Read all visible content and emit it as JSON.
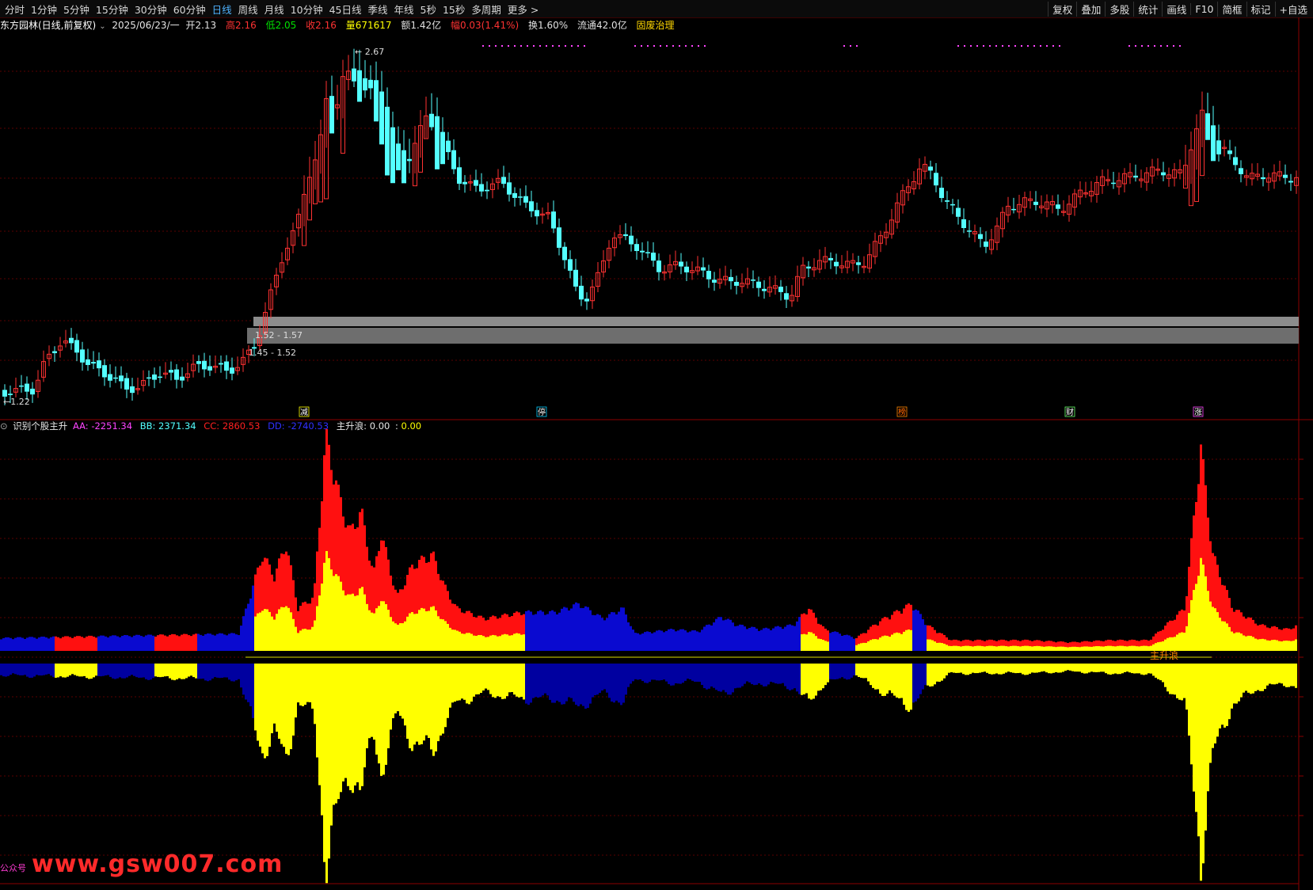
{
  "toolbar": {
    "periods": [
      "分时",
      "1分钟",
      "5分钟",
      "15分钟",
      "30分钟",
      "60分钟",
      "日线",
      "周线",
      "月线",
      "10分钟",
      "45日线",
      "季线",
      "年线",
      "5秒",
      "15秒",
      "多周期",
      "更多 >"
    ],
    "active_period": "日线",
    "right_buttons": [
      "复权",
      "叠加",
      "多股",
      "统计",
      "画线",
      "F10",
      "简框",
      "标记",
      "+自选"
    ]
  },
  "stock": {
    "title": "东方园林(日线,前复权)",
    "date": "2025/06/23/一",
    "open_label": "开",
    "open": "2.13",
    "high_label": "高",
    "high": "2.16",
    "low_label": "低",
    "low": "2.05",
    "close_label": "收",
    "close": "2.16",
    "volume_label": "量",
    "volume": "671617",
    "amount_label": "额",
    "amount": "1.42亿",
    "change_label": "幅",
    "change": "0.03(1.41%)",
    "turnover_label": "换",
    "turnover": "1.60%",
    "float_label": "流通",
    "float": "42.0亿",
    "concept": "固废治理"
  },
  "chart_labels": {
    "max_price": "2.67",
    "min_price": "1.22",
    "zone_upper": "1.52 - 1.57",
    "zone_lower": "1.45 - 1.52"
  },
  "event_markers": [
    "减",
    "停",
    "榜",
    "财",
    "涨"
  ],
  "indicator": {
    "name": "识别个股主升",
    "aa_label": "AA:",
    "aa": "-2251.34",
    "bb_label": "BB:",
    "bb": "2371.34",
    "cc_label": "CC:",
    "cc": "2860.53",
    "dd_label": "DD:",
    "dd": "-2740.53",
    "zs_label": "主升浪:",
    "zs1": "0.00",
    "zs2": "0.00",
    "signal_text": "主升浪"
  },
  "watermark": {
    "url": "www.gsw007.com",
    "small": "公众号"
  },
  "colors": {
    "up": "#ff3232",
    "down": "#54ffff",
    "aa": "#ff44ff",
    "bb": "#54ffff",
    "cc": "#ff2020",
    "dd": "#2020ff",
    "yellow": "#ffff00",
    "blue_fill": "#0a0ad0"
  }
}
